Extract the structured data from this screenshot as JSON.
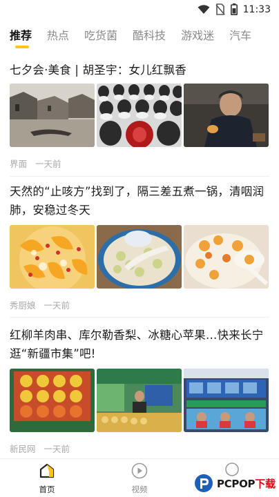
{
  "status_bar": {
    "time": "11:33",
    "icons": [
      "wifi-icon",
      "no-sim-icon",
      "battery-icon"
    ]
  },
  "tabs": [
    {
      "label": "推荐",
      "active": true
    },
    {
      "label": "热点"
    },
    {
      "label": "吃货菌"
    },
    {
      "label": "酷科技"
    },
    {
      "label": "游戏迷"
    },
    {
      "label": "汽车"
    }
  ],
  "accent_color": "#ffc51d",
  "articles": [
    {
      "title": "七夕会·美食 | 胡圣宇：女儿红飘香",
      "source": "界面",
      "time": "一天前",
      "images": [
        "town-canal-image",
        "wine-jars-image",
        "elderly-man-image"
      ]
    },
    {
      "title": "天然的“止咳方”找到了，隔三差五煮一锅，清咽润肺，安稳过冬天",
      "source": "秀厨娘",
      "time": "一天前",
      "images": [
        "peach-soup-image",
        "lotus-soup-image",
        "pear-soup-image"
      ]
    },
    {
      "title": "红柳羊肉串、库尔勒香梨、冰糖心苹果…快来长宁逛“新疆市集”吧!",
      "source": "新民网",
      "time": "一天前",
      "images": [
        "fruit-box-image",
        "market-stall-image",
        "market-booth-image"
      ]
    }
  ],
  "bottom_nav": [
    {
      "label": "首页",
      "icon": "home-icon",
      "active": true
    },
    {
      "label": "视频",
      "icon": "play-icon"
    },
    {
      "label": "",
      "icon": "profile-icon"
    }
  ],
  "watermark": {
    "text_prefix": "PCPOP",
    "text_suffix": "下载"
  }
}
